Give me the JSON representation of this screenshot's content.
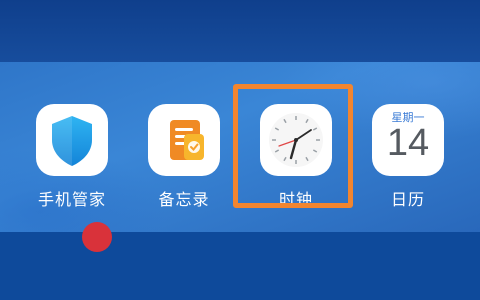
{
  "apps": [
    {
      "id": "phone-manager",
      "label": "手机管家",
      "icon": "shield-icon"
    },
    {
      "id": "notes",
      "label": "备忘录",
      "icon": "notes-icon"
    },
    {
      "id": "clock",
      "label": "时钟",
      "icon": "clock-icon"
    },
    {
      "id": "calendar",
      "label": "日历",
      "icon": "calendar-icon",
      "weekday": "星期一",
      "day": "14"
    }
  ],
  "highlight": {
    "target": "clock",
    "color": "#f2852f"
  },
  "colors": {
    "wallpaper": "#2f76c9",
    "shield": "#1a9be6",
    "notes_orange": "#f08a24",
    "calendar_blue": "#3a7bd5",
    "badge_red": "#d9323a"
  }
}
